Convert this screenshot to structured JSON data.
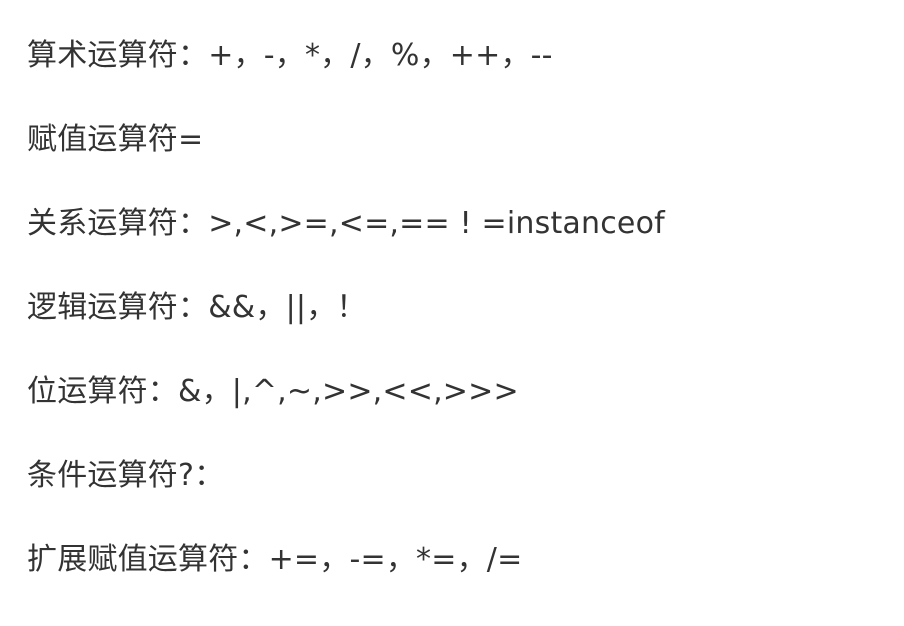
{
  "lines": [
    "算术运算符：+，-，*，/，%，++，--",
    "赋值运算符=",
    "关系运算符：>,<,>=,<=,== ! =instanceof",
    "逻辑运算符：&&，||，！",
    "位运算符：&，|,^,~,>>,<<,>>>",
    "条件运算符?：",
    "扩展赋值运算符：+=，-=，*=，/="
  ]
}
